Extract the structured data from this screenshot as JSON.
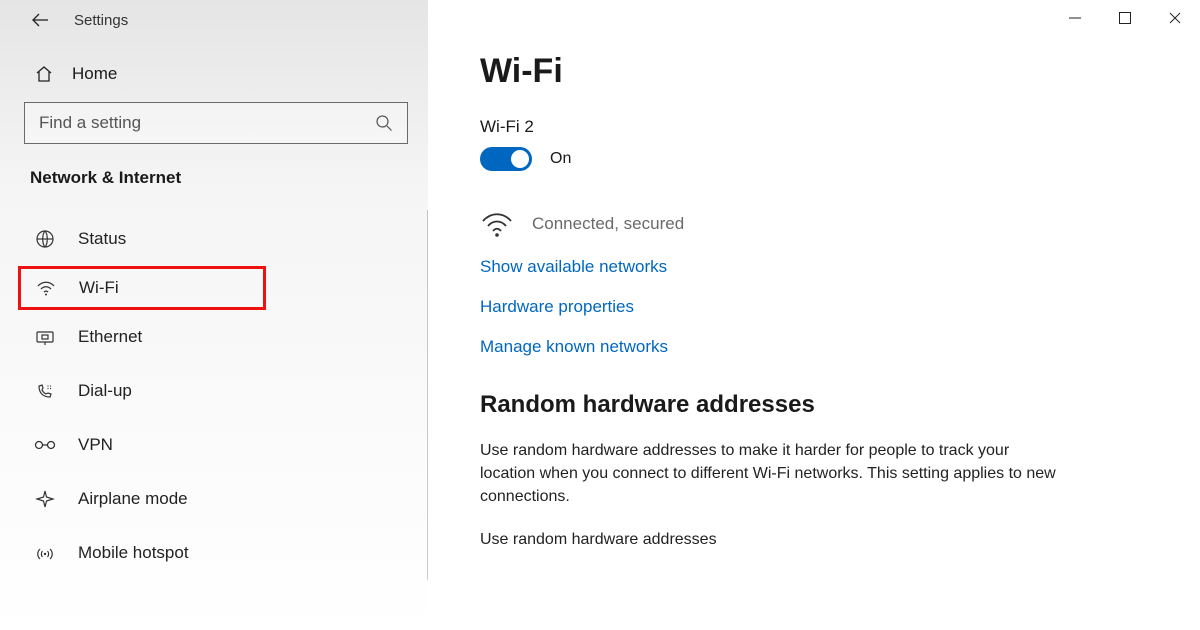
{
  "header": {
    "title": "Settings"
  },
  "home": {
    "label": "Home"
  },
  "search": {
    "placeholder": "Find a setting"
  },
  "category": "Network & Internet",
  "sidebar": {
    "items": [
      {
        "label": "Status"
      },
      {
        "label": "Wi-Fi"
      },
      {
        "label": "Ethernet"
      },
      {
        "label": "Dial-up"
      },
      {
        "label": "VPN"
      },
      {
        "label": "Airplane mode"
      },
      {
        "label": "Mobile hotspot"
      }
    ]
  },
  "main": {
    "title": "Wi-Fi",
    "adapter": "Wi-Fi 2",
    "toggle_state": "On",
    "status": "Connected, secured",
    "links": {
      "available": "Show available networks",
      "hardware": "Hardware properties",
      "manage": "Manage known networks"
    },
    "random": {
      "heading": "Random hardware addresses",
      "body": "Use random hardware addresses to make it harder for people to track your location when you connect to different Wi-Fi networks. This setting applies to new connections.",
      "sublabel": "Use random hardware addresses"
    }
  }
}
